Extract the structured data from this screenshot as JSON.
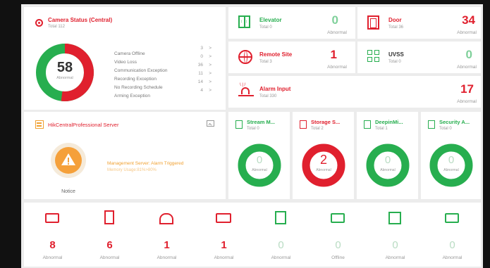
{
  "camera": {
    "title": "Camera Status (Central)",
    "total": "Total 112",
    "count": "58",
    "count_label": "Abnormal",
    "abnormal_fraction": 0.52,
    "rows": [
      {
        "label": "Camera Offline",
        "value": "3"
      },
      {
        "label": "Video Loss",
        "value": "0"
      },
      {
        "label": "Communication Exception",
        "value": "36"
      },
      {
        "label": "Recording Exception",
        "value": "11"
      },
      {
        "label": "No Recording Schedule",
        "value": "14"
      },
      {
        "label": "Arming Exception",
        "value": "4"
      }
    ],
    "chevron": ">"
  },
  "elevator": {
    "title": "Elevator",
    "total": "Total 0",
    "count": "0",
    "label": "Abnormal"
  },
  "door": {
    "title": "Door",
    "total": "Total 36",
    "count": "34",
    "label": "Abnormal"
  },
  "remote_site": {
    "title": "Remote Site",
    "total": "Total 3",
    "count": "1",
    "label": "Abnormal"
  },
  "uvss": {
    "title": "UVSS",
    "total": "Total 0",
    "count": "0",
    "label": "Abnormal"
  },
  "alarm_input": {
    "title": "Alarm Input",
    "total": "Total 330",
    "count": "17",
    "label": "Abnormal"
  },
  "server": {
    "title": "HikCentralProfessional Server",
    "message": "Management Server: Alarm Triggered",
    "memory": "Memory Usage:81%>80%",
    "notice": "Notice"
  },
  "mini_cards": [
    {
      "title": "Stream M...",
      "total": "Total 0",
      "count": "0",
      "label": "Abnormal",
      "status": "ok"
    },
    {
      "title": "Storage S...",
      "total": "Total 2",
      "count": "2",
      "label": "Abnormal",
      "status": "alarm"
    },
    {
      "title": "DeepinMi...",
      "total": "Total 1",
      "count": "0",
      "label": "Abnormal",
      "status": "ok"
    },
    {
      "title": "Security A...",
      "total": "Total 0",
      "count": "0",
      "label": "Abnormal",
      "status": "ok"
    }
  ],
  "bottom": [
    {
      "icon": "encoder-red-icon",
      "count": "8",
      "label": "Abnormal",
      "status": "alarm"
    },
    {
      "icon": "door-station-icon",
      "count": "6",
      "label": "Abnormal",
      "status": "alarm"
    },
    {
      "icon": "alarm-panel-icon",
      "count": "1",
      "label": "Abnormal",
      "status": "alarm"
    },
    {
      "icon": "decoder-icon",
      "count": "1",
      "label": "Abnormal",
      "status": "alarm"
    },
    {
      "icon": "elevator-controller-icon",
      "count": "0",
      "label": "Abnormal",
      "status": "ok"
    },
    {
      "icon": "encoder-green-icon",
      "count": "0",
      "label": "Offline",
      "status": "ok"
    },
    {
      "icon": "indoor-station-icon",
      "count": "0",
      "label": "Abnormal",
      "status": "ok"
    },
    {
      "icon": "network-device-icon",
      "count": "0",
      "label": "Abnormal",
      "status": "ok"
    }
  ],
  "colors": {
    "red": "#e0202e",
    "green": "#27ae4f",
    "orange": "#f0a030"
  }
}
